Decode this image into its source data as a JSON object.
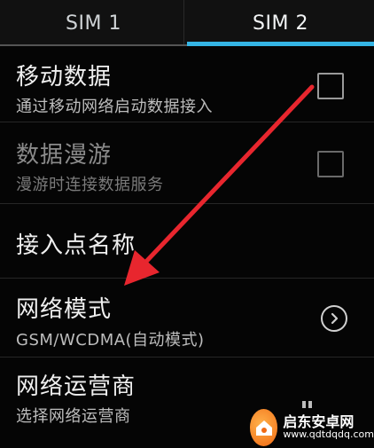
{
  "tabs": [
    {
      "label": "SIM 1",
      "active": false
    },
    {
      "label": "SIM 2",
      "active": true
    }
  ],
  "settings": {
    "mobile_data": {
      "title": "移动数据",
      "summary": "通过移动网络启动数据接入",
      "checked": false,
      "enabled": true
    },
    "data_roaming": {
      "title": "数据漫游",
      "summary": "漫游时连接数据服务",
      "checked": false,
      "enabled": false
    },
    "apn": {
      "title": "接入点名称"
    },
    "network_mode": {
      "title": "网络模式",
      "summary": "GSM/WCDMA(自动模式)"
    },
    "network_operator": {
      "title": "网络运营商",
      "summary": "选择网络运营商"
    }
  },
  "watermark": {
    "name": "启东安卓网",
    "url": "www.qdtdqdq.com"
  },
  "colors": {
    "accent": "#35b5e5",
    "annotation_arrow": "#e8262e",
    "watermark_orange": "#f07a1e"
  },
  "icons": {
    "checkbox": "checkbox-icon",
    "chevron": "chevron-right-circle-icon",
    "logo": "watermark-logo-icon"
  }
}
